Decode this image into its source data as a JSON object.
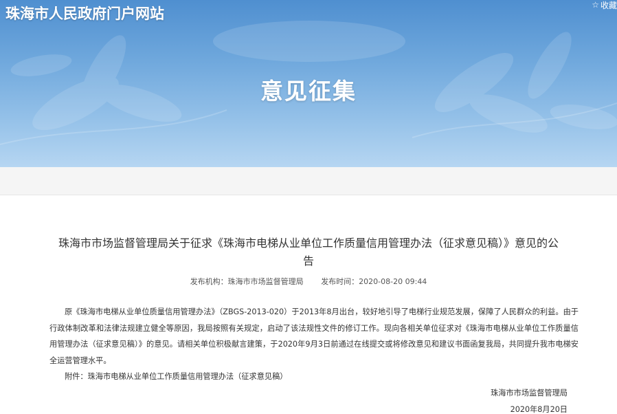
{
  "header": {
    "site_title": "珠海市人民政府门户网站",
    "favorite_label": "收藏",
    "favorite_icon": "star-icon",
    "banner_heading": "意见征集"
  },
  "article": {
    "title": "珠海市市场监督管理局关于征求《珠海市电梯从业单位工作质量信用管理办法（征求意见稿）》意见的公告",
    "publisher": "发布机构：珠海市市场监督管理局",
    "publish_time": "发布时间：2020-08-20 09:44",
    "body": "原《珠海市电梯从业单位质量信用管理办法》（ZBGS-2013-020）于2013年8月出台，较好地引导了电梯行业规范发展，保障了人民群众的利益。由于行政体制改革和法律法规建立健全等原因，我局按照有关规定，启动了该法规性文件的修订工作。现向各相关单位征求对《珠海市电梯从业单位工作质量信用管理办法（征求意见稿）》的意见。请相关单位积极献言建策，于2020年9月3日前通过在线提交或将修改意见和建议书面函复我局，共同提升我市电梯安全运营管理水平。",
    "attachment": "附件：珠海市电梯从业单位工作质量信用管理办法（征求意见稿）",
    "signature_org": "珠海市市场监督管理局",
    "signature_date": "2020年8月20日"
  }
}
